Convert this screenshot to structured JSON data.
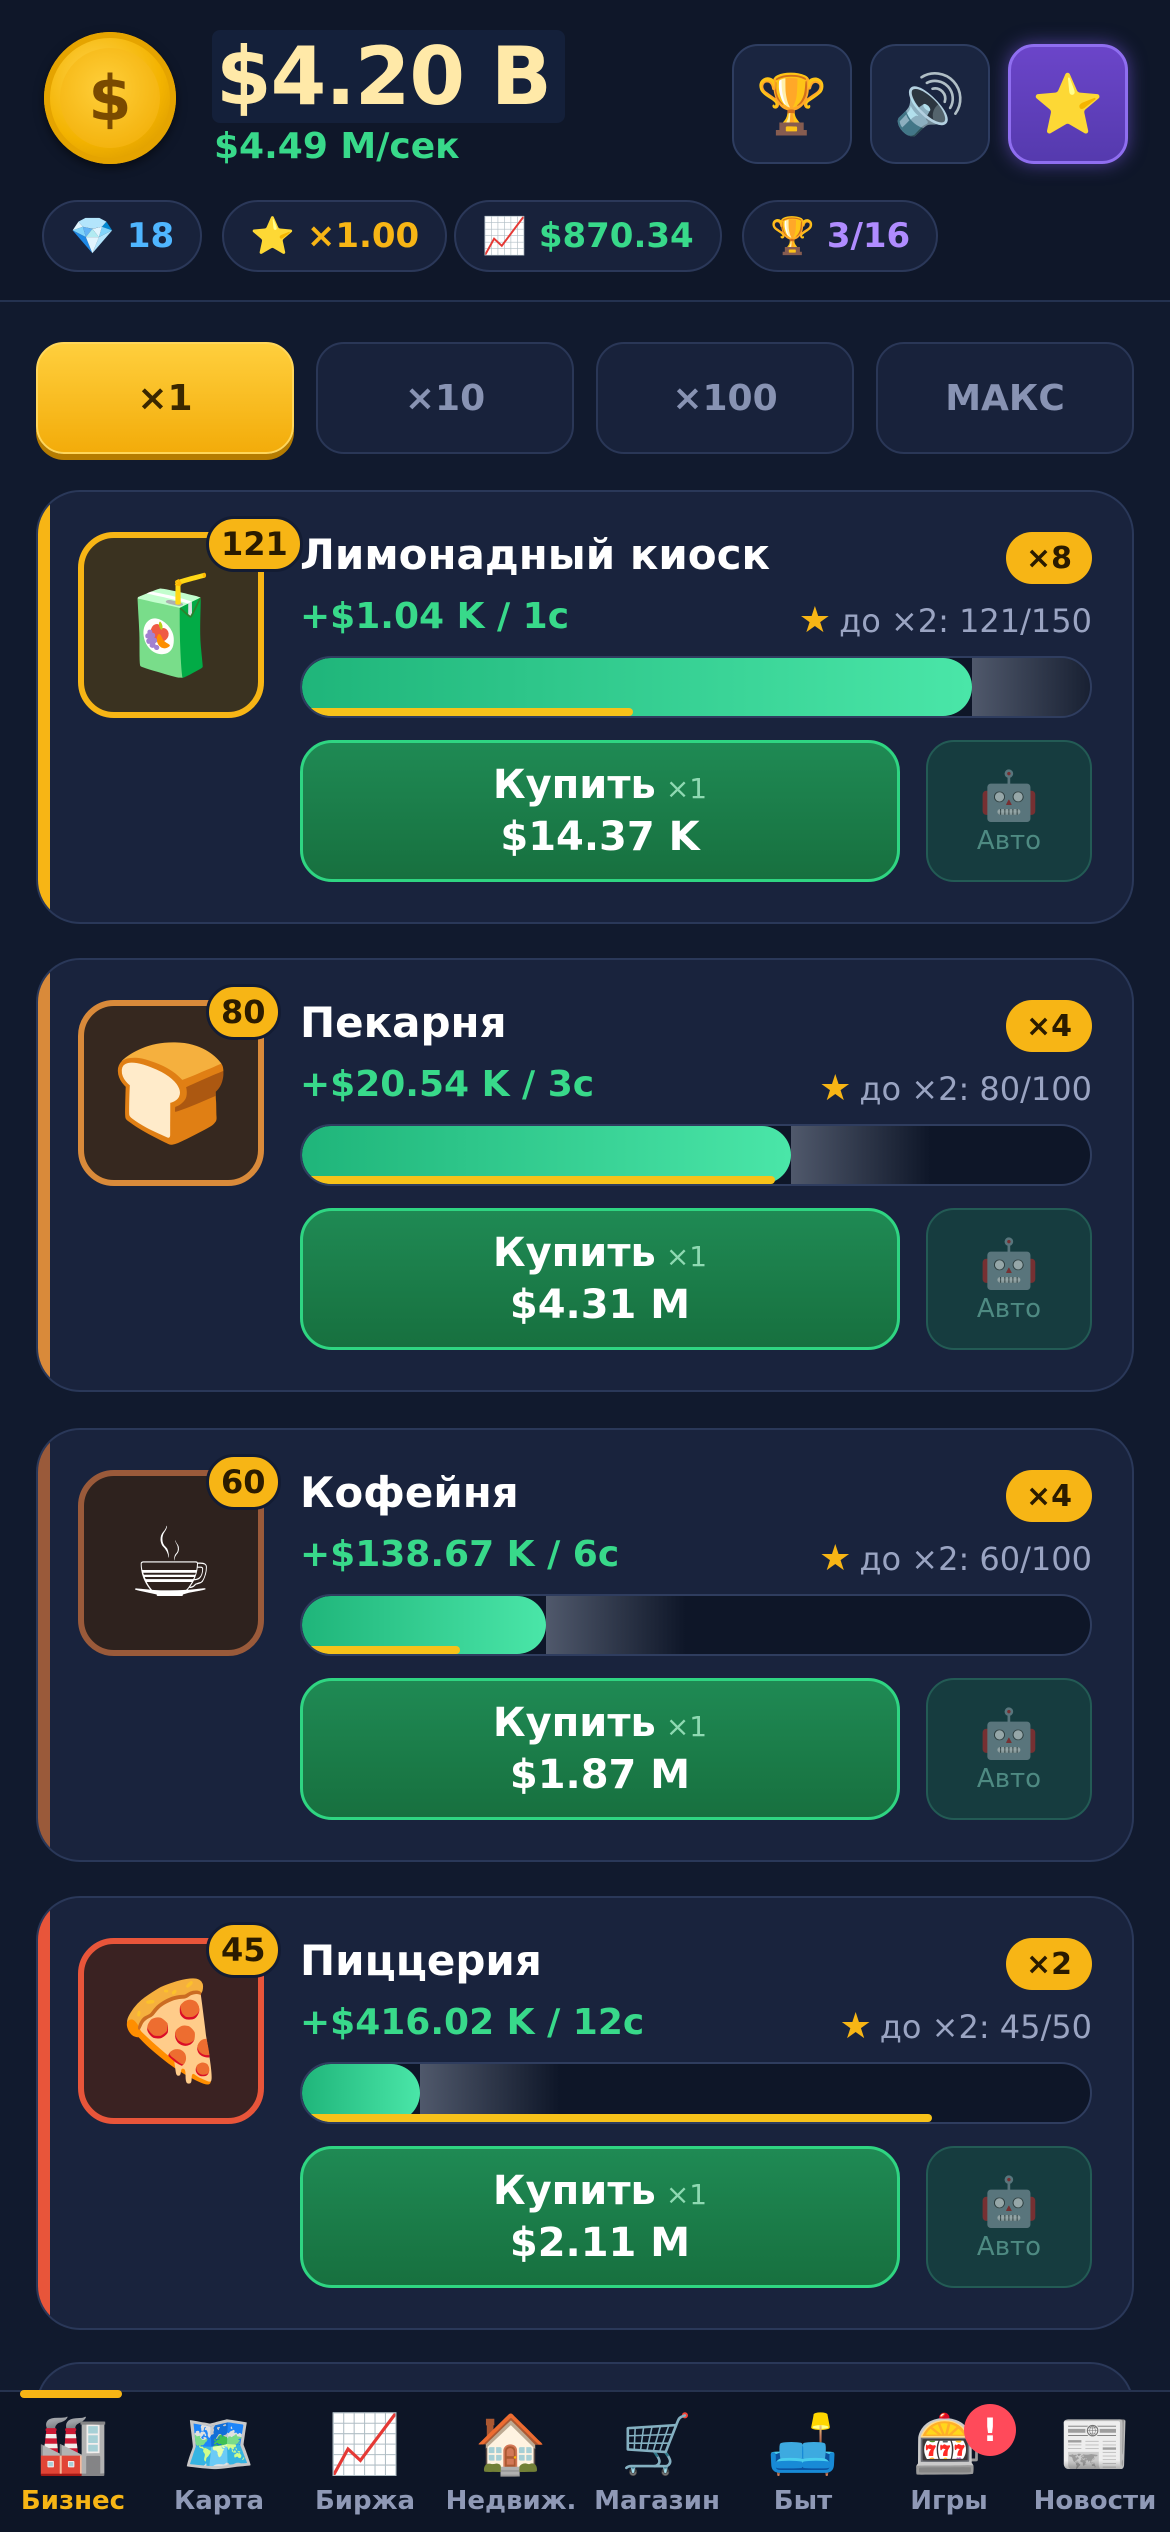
{
  "header": {
    "balance": "$4.20 B",
    "rate": "$4.49 M/сек",
    "coin_symbol": "$",
    "buttons": [
      {
        "icon": "trophy-icon",
        "glyph": "🏆"
      },
      {
        "icon": "speaker-icon",
        "glyph": "🔊"
      },
      {
        "icon": "star-icon",
        "glyph": "⭐"
      }
    ],
    "stats": [
      {
        "icon": "gem-icon",
        "glyph": "💎",
        "value": "18",
        "color": "#4fb6ff"
      },
      {
        "icon": "star-icon",
        "glyph": "⭐",
        "value": "×1.00",
        "color": "#f7b515"
      },
      {
        "icon": "chart-up-icon",
        "glyph": "📈",
        "value": "$870.34",
        "color": "#38d98a"
      },
      {
        "icon": "trophy-icon",
        "glyph": "🏆",
        "value": "3/16",
        "color": "#b08cff"
      }
    ]
  },
  "multiplier_tabs": [
    {
      "label": "×1",
      "active": true
    },
    {
      "label": "×10",
      "active": false
    },
    {
      "label": "×100",
      "active": false
    },
    {
      "label": "МАКС",
      "active": false
    }
  ],
  "businesses": [
    {
      "name": "Лимонадный киоск",
      "level": "121",
      "multiplier": "×8",
      "income": "+$1.04 K / 1с",
      "goal": "до ×2: 121/150",
      "progress": 0.85,
      "goal_progress": 0.42,
      "buy_label": "Купить",
      "buy_qty": "×1",
      "price": "$14.37 K",
      "auto_label": "Авто",
      "auto_glyph": "🤖",
      "icon": "lemonade-icon",
      "glyph": "🧃",
      "accent": "#f7b515",
      "icon_bg": "#3a3220"
    },
    {
      "name": "Пекарня",
      "level": "80",
      "multiplier": "×4",
      "income": "+$20.54 K / 3с",
      "goal": "до ×2: 80/100",
      "progress": 0.62,
      "goal_progress": 0.6,
      "buy_label": "Купить",
      "buy_qty": "×1",
      "price": "$4.31 M",
      "auto_label": "Авто",
      "auto_glyph": "🤖",
      "icon": "bread-icon",
      "glyph": "🍞",
      "accent": "#d98a3a",
      "icon_bg": "#36281f"
    },
    {
      "name": "Кофейня",
      "level": "60",
      "multiplier": "×4",
      "income": "+$138.67 K / 6с",
      "goal": "до ×2: 60/100",
      "progress": 0.31,
      "goal_progress": 0.2,
      "buy_label": "Купить",
      "buy_qty": "×1",
      "price": "$1.87 M",
      "auto_label": "Авто",
      "auto_glyph": "🤖",
      "icon": "coffee-icon",
      "glyph": "☕",
      "accent": "#9a5a3a",
      "icon_bg": "#2e221e"
    },
    {
      "name": "Пиццерия",
      "level": "45",
      "multiplier": "×2",
      "income": "+$416.02 K / 12с",
      "goal": "до ×2: 45/50",
      "progress": 0.15,
      "goal_progress": 0.8,
      "buy_label": "Купить",
      "buy_qty": "×1",
      "price": "$2.11 M",
      "auto_label": "Авто",
      "auto_glyph": "🤖",
      "icon": "pizza-icon",
      "glyph": "🍕",
      "accent": "#e8553a",
      "icon_bg": "#3a2222"
    }
  ],
  "nav": [
    {
      "label": "Бизнес",
      "icon": "factory-icon",
      "glyph": "🏭",
      "active": true
    },
    {
      "label": "Карта",
      "icon": "map-icon",
      "glyph": "🗺️",
      "active": false
    },
    {
      "label": "Биржа",
      "icon": "chart-up-icon",
      "glyph": "📈",
      "active": false
    },
    {
      "label": "Недвиж.",
      "icon": "house-icon",
      "glyph": "🏠",
      "active": false
    },
    {
      "label": "Магазин",
      "icon": "cart-icon",
      "glyph": "🛒",
      "active": false
    },
    {
      "label": "Быт",
      "icon": "sofa-icon",
      "glyph": "🛋️",
      "active": false
    },
    {
      "label": "Игры",
      "icon": "slot-machine-icon",
      "glyph": "🎰",
      "active": false
    },
    {
      "label": "Новости",
      "icon": "newspaper-icon",
      "glyph": "📰",
      "active": false
    }
  ],
  "nav_badge": "!"
}
